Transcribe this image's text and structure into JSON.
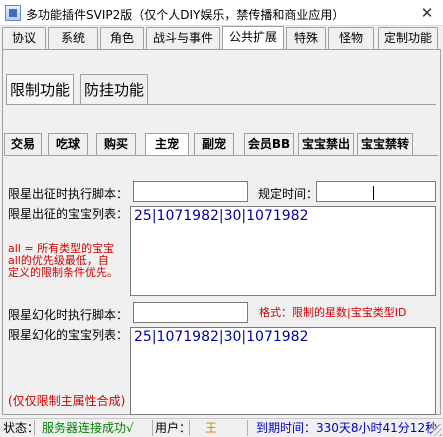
{
  "window": {
    "title": "多功能插件SVIP2版（仅个人DIY娱乐，禁传播和商业应用）",
    "close_glyph": "✕"
  },
  "main_tabs": [
    {
      "label": "协议",
      "active": false
    },
    {
      "label": "系统",
      "active": false
    },
    {
      "label": "角色",
      "active": false
    },
    {
      "label": "战斗与事件",
      "active": false
    },
    {
      "label": "公共扩展",
      "active": true
    },
    {
      "label": "特殊",
      "active": false
    },
    {
      "label": "怪物",
      "active": false
    },
    {
      "label": "定制功能",
      "active": false
    }
  ],
  "sub_tabs": [
    {
      "label": "限制功能",
      "active": true
    },
    {
      "label": "防挂功能",
      "active": false
    }
  ],
  "tabs3": [
    {
      "label": "交易",
      "active": false
    },
    {
      "label": "吃球",
      "active": false
    },
    {
      "label": "购买",
      "active": false
    },
    {
      "label": "主宠",
      "active": true
    },
    {
      "label": "副宠",
      "active": false
    },
    {
      "label": "会员BB",
      "active": false
    },
    {
      "label": "宝宝禁出",
      "active": false
    },
    {
      "label": "宝宝禁转",
      "active": false
    }
  ],
  "form": {
    "summon_script_label": "限星出征时执行脚本：",
    "summon_script_value": "",
    "time_label": "规定时间：",
    "time_value": "",
    "summon_list_label": "限星出征的宝宝列表：",
    "summon_list_value": "25|1071982|30|1071982",
    "all_note_line1": "all = 所有类型的宝宝",
    "all_note_line2": "all的优先级最低，自",
    "all_note_line3": "定义的限制条件优先。",
    "morph_script_label": "限星幻化时执行脚本：",
    "morph_script_value": "",
    "format_note": "格式：限制的星数|宝宝类型ID",
    "morph_list_label": "限星幻化的宝宝列表：",
    "morph_list_value": "25|1071982|30|1071982",
    "morph_note": "(仅仅限制主属性合成)"
  },
  "status": {
    "state_label": "状态：",
    "state_value": "服务器连接成功√",
    "user_label": "用户：",
    "user_value": "王",
    "expiry": "到期时间：330天8小时41分12秒"
  },
  "colors": {
    "note_red": "#d00000",
    "list_blue": "#0000a0",
    "status_green": "#008000",
    "status_orange": "#e08000",
    "status_blue": "#0000c8"
  }
}
